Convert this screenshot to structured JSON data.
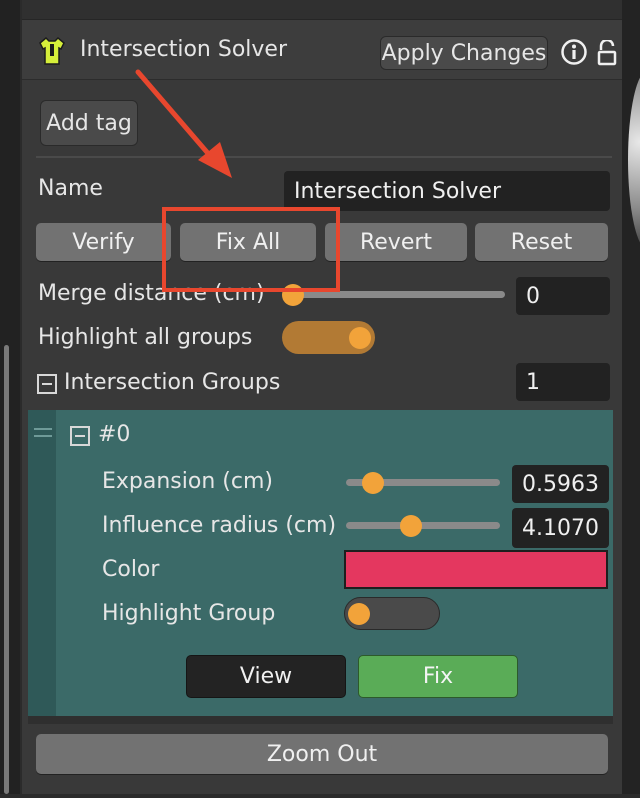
{
  "header": {
    "title": "Intersection Solver",
    "apply_label": "Apply Changes"
  },
  "tags": {
    "add_label": "Add tag"
  },
  "name": {
    "label": "Name",
    "value": "Intersection Solver"
  },
  "actions": {
    "verify": "Verify",
    "fix_all": "Fix All",
    "revert": "Revert",
    "reset": "Reset"
  },
  "merge": {
    "label": "Merge distance (cm)",
    "value": "0",
    "slider_fraction": 0.0
  },
  "highlight_all": {
    "label": "Highlight all groups",
    "on": true
  },
  "groups": {
    "label": "Intersection Groups",
    "count": "1"
  },
  "group0": {
    "title": "#0",
    "expansion": {
      "label": "Expansion (cm)",
      "value": "0.5963",
      "slider_fraction": 0.15
    },
    "influence": {
      "label": "Influence radius (cm)",
      "value": "4.1070",
      "slider_fraction": 0.42
    },
    "color": {
      "label": "Color",
      "value": "#e4375f"
    },
    "highlight": {
      "label": "Highlight Group",
      "on": false
    },
    "view_label": "View",
    "fix_label": "Fix"
  },
  "zoom_out_label": "Zoom Out",
  "colors": {
    "accent_orange": "#f2a33a",
    "annotation_red": "#e8472e",
    "fix_green": "#5aac57",
    "group_teal": "#3b6a68"
  }
}
